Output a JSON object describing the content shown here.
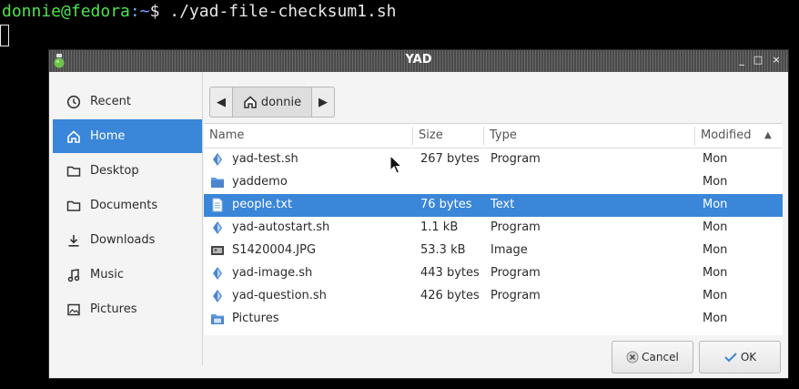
{
  "terminal": {
    "user_host": "donnie@fedora",
    "path": ":~",
    "symbol": "$",
    "command": " ./yad-file-checksum1.sh"
  },
  "window": {
    "title": "YAD",
    "controls": {
      "minimize": "_",
      "maximize": "□",
      "close": "×"
    }
  },
  "sidebar": {
    "items": [
      {
        "label": "Recent",
        "icon": "clock-icon"
      },
      {
        "label": "Home",
        "icon": "home-icon",
        "active": true
      },
      {
        "label": "Desktop",
        "icon": "folder-icon"
      },
      {
        "label": "Documents",
        "icon": "folder-icon"
      },
      {
        "label": "Downloads",
        "icon": "download-icon"
      },
      {
        "label": "Music",
        "icon": "music-icon"
      },
      {
        "label": "Pictures",
        "icon": "picture-icon"
      }
    ]
  },
  "pathbar": {
    "back": "◀",
    "current": "donnie",
    "forward": "▶"
  },
  "filelist": {
    "columns": {
      "name": "Name",
      "size": "Size",
      "type": "Type",
      "modified": "Modified",
      "sort_indicator": "▲"
    },
    "rows": [
      {
        "name": "yad-test.sh",
        "size": "267 bytes",
        "type": "Program",
        "modified": "Mon",
        "icon": "script-icon"
      },
      {
        "name": "yaddemo",
        "size": "",
        "type": "",
        "modified": "Mon",
        "icon": "folder-icon"
      },
      {
        "name": "people.txt",
        "size": "76 bytes",
        "type": "Text",
        "modified": "Mon",
        "icon": "text-file-icon",
        "selected": true
      },
      {
        "name": "yad-autostart.sh",
        "size": "1.1 kB",
        "type": "Program",
        "modified": "Mon",
        "icon": "script-icon"
      },
      {
        "name": "S1420004.JPG",
        "size": "53.3 kB",
        "type": "Image",
        "modified": "Mon",
        "icon": "image-file-icon"
      },
      {
        "name": "yad-image.sh",
        "size": "443 bytes",
        "type": "Program",
        "modified": "Mon",
        "icon": "script-icon"
      },
      {
        "name": "yad-question.sh",
        "size": "426 bytes",
        "type": "Program",
        "modified": "Mon",
        "icon": "script-icon"
      },
      {
        "name": "Pictures",
        "size": "",
        "type": "",
        "modified": "Mon",
        "icon": "pictures-folder-icon"
      }
    ]
  },
  "buttons": {
    "cancel": "Cancel",
    "ok": "OK"
  },
  "colors": {
    "selection": "#3a86d9",
    "terminal_green": "#4ee44e",
    "terminal_blue": "#7aa6ff"
  }
}
